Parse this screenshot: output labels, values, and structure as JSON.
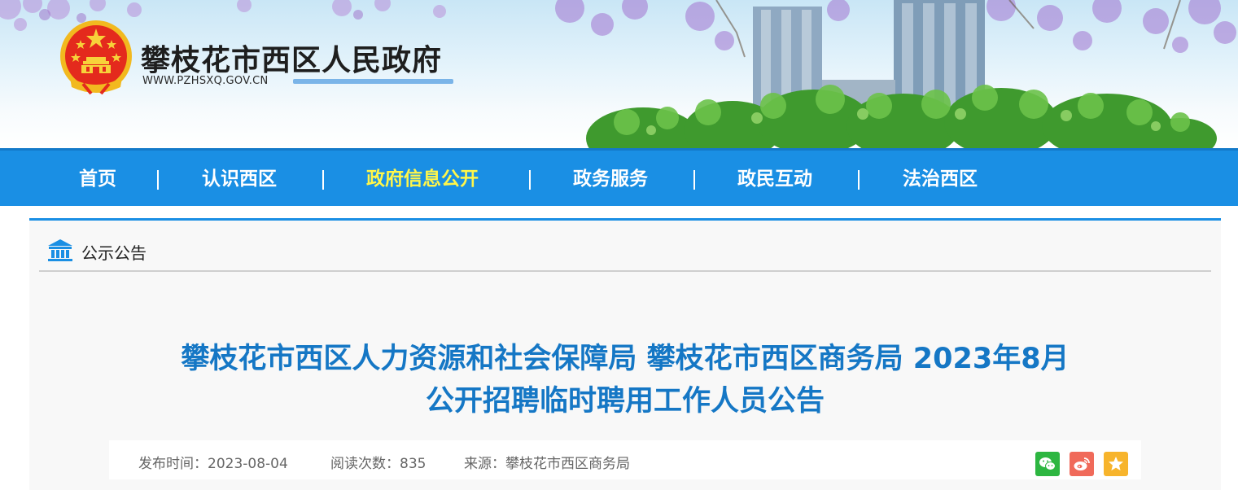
{
  "header": {
    "site_title": "攀枝花市西区人民政府",
    "site_url": "WWW.PZHSXQ.GOV.CN",
    "emblem_icon": "national-emblem-icon"
  },
  "nav": {
    "items": [
      {
        "label": "首页"
      },
      {
        "label": "认识西区"
      },
      {
        "label": "政府信息公开"
      },
      {
        "label": "政务服务"
      },
      {
        "label": "政民互动"
      },
      {
        "label": "法治西区"
      }
    ],
    "active_index": 2,
    "background": "#1a8fe4",
    "active_color": "#fff64a"
  },
  "breadcrumb": {
    "icon": "building-icon",
    "label": "公示公告"
  },
  "article": {
    "title_line1": "攀枝花市西区人力资源和社会保障局 攀枝花市西区商务局 2023年8月",
    "title_line2": "公开招聘临时聘用工作人员公告",
    "title_color": "#1577c5",
    "publish_time": "发布时间：2023-08-04",
    "read_count": "阅读次数：835",
    "source": "来源：攀枝花市西区商务局"
  },
  "share": {
    "wechat_icon": "wechat-icon",
    "weibo_icon": "weibo-icon",
    "favorite_icon": "star-icon",
    "colors": {
      "wechat": "#2db641",
      "weibo": "#f06a5a",
      "favorite": "#f7b42c"
    }
  }
}
